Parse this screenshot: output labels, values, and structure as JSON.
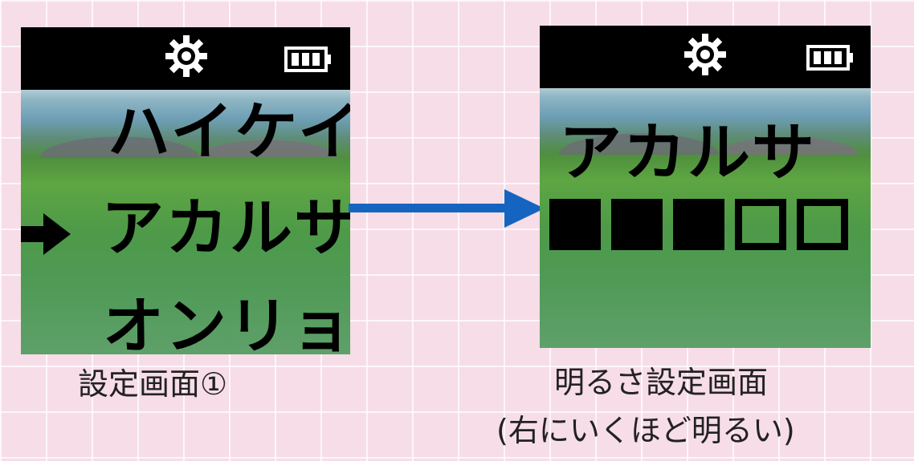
{
  "settings_screen": {
    "menu_items": [
      "ハイケイ",
      "アカルサ",
      "オンリョウ"
    ],
    "selected_index": 1,
    "cursor_icon": "right-arrow-icon",
    "status_icons": [
      "gear-icon",
      "battery-full-icon"
    ],
    "caption": "設定画面①"
  },
  "brightness_screen": {
    "title": "アカルサ",
    "level": 3,
    "level_max": 5,
    "caption_line1": "明るさ設定画面",
    "caption_line2": "(右にいくほど明るい)"
  },
  "colors": {
    "arrow": "#1565c0",
    "background": "#f6dde7",
    "status_bar": "#000000"
  }
}
